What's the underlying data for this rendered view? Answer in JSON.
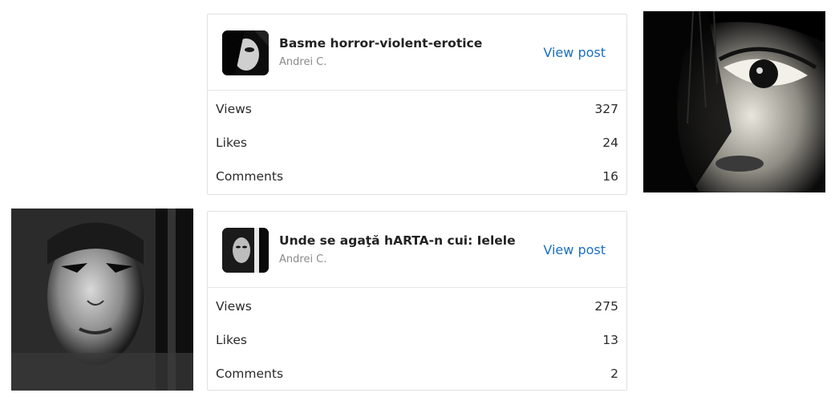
{
  "posts": [
    {
      "title": "Basme horror-violent-erotice",
      "author": "Andrei C.",
      "view_label": "View post",
      "stats": [
        {
          "label": "Views",
          "value": "327"
        },
        {
          "label": "Likes",
          "value": "24"
        },
        {
          "label": "Comments",
          "value": "16"
        }
      ]
    },
    {
      "title": "Unde se agaţă hARTA-n cui: Ielele",
      "author": "Andrei C.",
      "view_label": "View post",
      "stats": [
        {
          "label": "Views",
          "value": "275"
        },
        {
          "label": "Likes",
          "value": "13"
        },
        {
          "label": "Comments",
          "value": "2"
        }
      ]
    }
  ],
  "colors": {
    "link": "#1a6fc7",
    "border": "#e1e1e1",
    "muted_text": "#8a8a8a"
  }
}
